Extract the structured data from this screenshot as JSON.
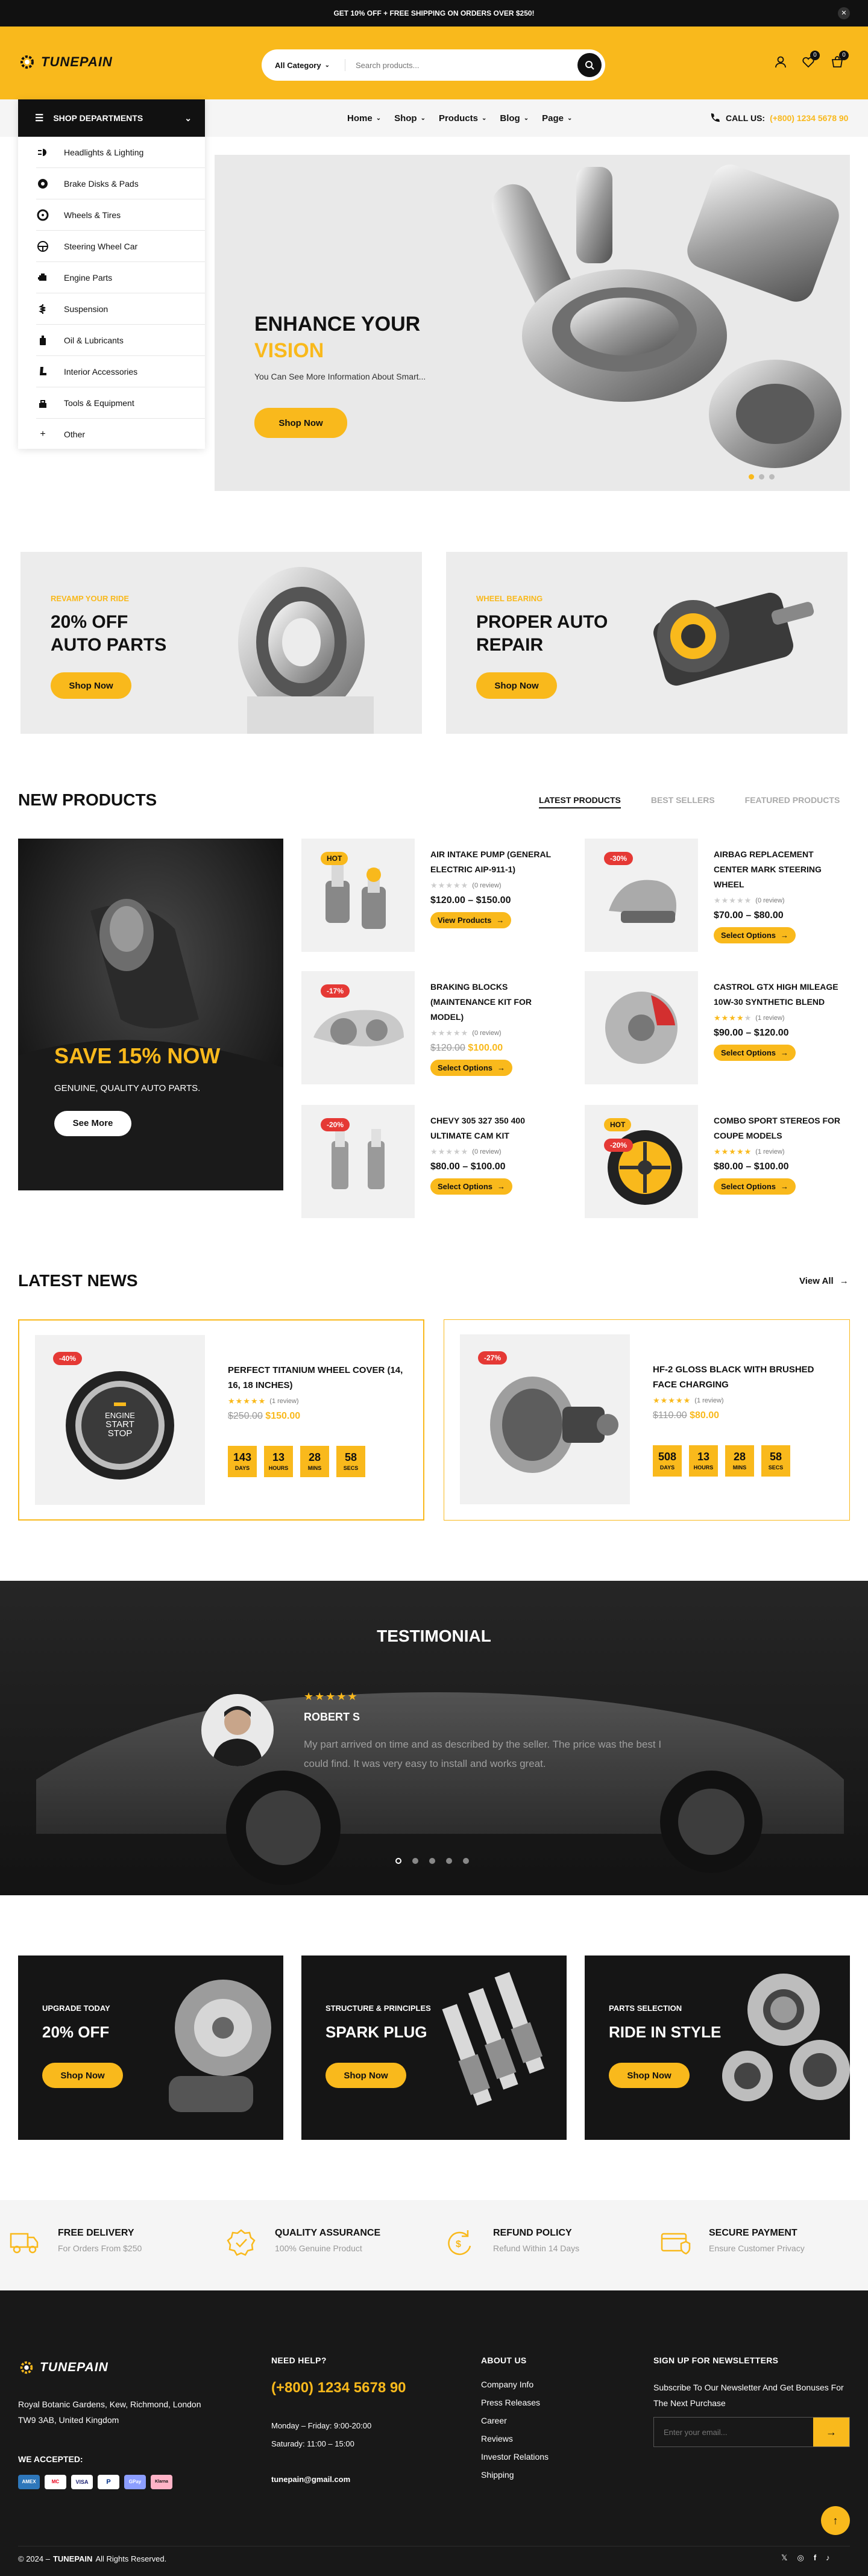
{
  "topbar": {
    "promo": "GET 10% OFF + FREE SHIPPING ON ORDERS OVER $250!"
  },
  "header": {
    "brand": "TUNEPAIN",
    "category_label": "All Category",
    "search_placeholder": "Search products...",
    "wishlist_count": "0",
    "cart_count": "0"
  },
  "nav": {
    "departments_label": "SHOP DEPARTMENTS",
    "links": [
      "Home",
      "Shop",
      "Products",
      "Blog",
      "Page"
    ],
    "call_label": "CALL US:",
    "call_number": "(+800) 1234 5678 90"
  },
  "departments": [
    "Headlights & Lighting",
    "Brake Disks & Pads",
    "Wheels & Tires",
    "Steering Wheel Car",
    "Engine Parts",
    "Suspension",
    "Oil & Lubricants",
    "Interior Accessories",
    "Tools & Equipment",
    "Other"
  ],
  "hero": {
    "title_line1": "ENHANCE YOUR",
    "title_line2": "VISION",
    "subtitle": "You Can See More Information About Smart...",
    "button": "Shop Now"
  },
  "promo_banners": [
    {
      "kicker": "REVAMP YOUR RIDE",
      "line1": "20% OFF",
      "line2": "AUTO PARTS",
      "button": "Shop Now"
    },
    {
      "kicker": "WHEEL BEARING",
      "line1": "PROPER AUTO",
      "line2": "REPAIR",
      "button": "Shop Now"
    }
  ],
  "new_products": {
    "heading": "NEW PRODUCTS",
    "tabs": [
      "LATEST PRODUCTS",
      "BEST SELLERS",
      "FEATURED PRODUCTS"
    ],
    "side_banner": {
      "title": "SAVE 15% NOW",
      "subtitle": "GENUINE, QUALITY AUTO PARTS.",
      "button": "See More"
    },
    "items": [
      {
        "badge": "HOT",
        "title": "AIR INTAKE PUMP (GENERAL ELECTRIC AIP-911-1)",
        "reviews": "(0 review)",
        "price": "$120.00 – $150.00",
        "old_price": "",
        "button": "View Products"
      },
      {
        "badge": "-30%",
        "title": "AIRBAG REPLACEMENT CENTER MARK STEERING WHEEL",
        "reviews": "(0 review)",
        "price": "$70.00 – $80.00",
        "old_price": "",
        "button": "Select Options"
      },
      {
        "badge": "-17%",
        "title": "BRAKING BLOCKS (MAINTENANCE KIT FOR MODEL)",
        "reviews": "(0 review)",
        "price": "$100.00",
        "old_price": "$120.00",
        "button": "Select Options"
      },
      {
        "badge": "",
        "title": "CASTROL GTX HIGH MILEAGE 10W-30 SYNTHETIC BLEND",
        "reviews": "(1 review)",
        "price": "$90.00 – $120.00",
        "old_price": "",
        "button": "Select Options"
      },
      {
        "badge": "-20%",
        "title": "CHEVY 305 327 350 400 ULTIMATE CAM KIT",
        "reviews": "(0 review)",
        "price": "$80.00 – $100.00",
        "old_price": "",
        "button": "Select Options"
      },
      {
        "badge": "HOT",
        "badge2": "-20%",
        "title": "COMBO SPORT STEREOS FOR COUPE MODELS",
        "reviews": "(1 review)",
        "price": "$80.00 – $100.00",
        "old_price": "",
        "button": "Select Options"
      }
    ],
    "ratings": [
      0,
      0,
      0,
      4,
      0,
      5
    ]
  },
  "latest_news": {
    "heading": "LATEST NEWS",
    "view_all": "View All",
    "items": [
      {
        "badge": "-40%",
        "title": "PERFECT TITANIUM WHEEL COVER (14, 16, 18 INCHES)",
        "reviews": "(1 review)",
        "old_price": "$250.00",
        "price": "$150.00",
        "countdown": [
          "143",
          "13",
          "28",
          "58"
        ],
        "engine_line1": "ENGINE",
        "engine_line2": "START",
        "engine_line3": "STOP"
      },
      {
        "badge": "-27%",
        "title": "HF-2 GLOSS BLACK WITH BRUSHED FACE CHARGING",
        "reviews": "(1 review)",
        "old_price": "$110.00",
        "price": "$80.00",
        "countdown": [
          "508",
          "13",
          "28",
          "58"
        ]
      }
    ],
    "countdown_labels": [
      "DAYS",
      "HOURS",
      "MINS",
      "SECS"
    ]
  },
  "testimonial": {
    "heading": "TESTIMONIAL",
    "name": "ROBERT S",
    "text": "My part arrived on time and as described by the seller. The price was the best I could find. It was very easy to install and works great."
  },
  "triple_banners": [
    {
      "kicker": "UPGRADE TODAY",
      "title": "20% OFF",
      "button": "Shop Now"
    },
    {
      "kicker": "STRUCTURE & PRINCIPLES",
      "title": "SPARK PLUG",
      "button": "Shop Now"
    },
    {
      "kicker": "PARTS SELECTION",
      "title": "RIDE IN STYLE",
      "button": "Shop Now"
    }
  ],
  "features": [
    {
      "icon": "truck-icon",
      "title": "FREE DELIVERY",
      "sub": "For Orders From $250"
    },
    {
      "icon": "quality-badge-icon",
      "title": "QUALITY ASSURANCE",
      "sub": "100% Genuine Product"
    },
    {
      "icon": "refund-icon",
      "title": "REFUND POLICY",
      "sub": "Refund Within 14 Days"
    },
    {
      "icon": "secure-card-icon",
      "title": "SECURE PAYMENT",
      "sub": "Ensure Customer Privacy"
    }
  ],
  "footer": {
    "brand": "TUNEPAIN",
    "address_line1": "Royal Botanic Gardens, Kew, Richmond, London",
    "address_line2": "TW9 3AB, United Kingdom",
    "we_accepted": "WE ACCEPTED:",
    "payments": [
      "AMEX",
      "MC",
      "VISA",
      "P",
      "GPay",
      "Klarna"
    ],
    "need_help": "NEED HELP?",
    "phone": "(+800) 1234 5678 90",
    "hours1": "Monday – Friday: 9:00-20:00",
    "hours2": "Saturady: 11:00 – 15:00",
    "email": "tunepain@gmail.com",
    "about_heading": "ABOUT US",
    "about_links": [
      "Company Info",
      "Press Releases",
      "Career",
      "Reviews",
      "Investor Relations",
      "Shipping"
    ],
    "newsletter_heading": "SIGN UP FOR NEWSLETTERS",
    "newsletter_text": "Subscribe To Our Newsletter And Get Bonuses For The Next Purchase",
    "email_placeholder": "Enter your email...",
    "copyright_prefix": "© 2024 –",
    "copyright_brand": "TUNEPAIN",
    "copyright_suffix": "All Rights Reserved."
  },
  "colors": {
    "accent": "#f9b91c",
    "sale_red": "#e53935",
    "dark": "#111111"
  }
}
